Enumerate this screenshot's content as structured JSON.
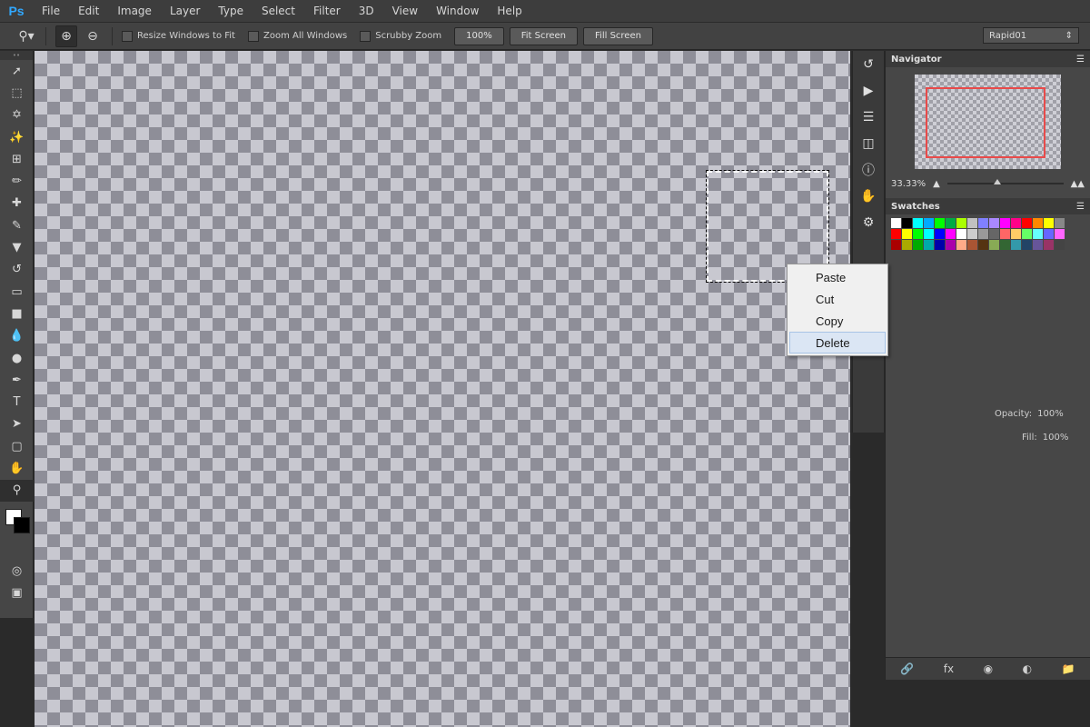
{
  "menubar": {
    "logo": "Ps",
    "items": [
      "File",
      "Edit",
      "Image",
      "Layer",
      "Type",
      "Select",
      "Filter",
      "3D",
      "View",
      "Window",
      "Help"
    ]
  },
  "options": {
    "zoom_in_icon": "zoom-in",
    "zoom_out_icon": "zoom-out",
    "resize_windows": "Resize Windows to Fit",
    "zoom_all_windows": "Zoom All Windows",
    "scrubby_zoom": "Scrubby Zoom",
    "zoom_100": "100%",
    "fit_screen": "Fit Screen",
    "fill_screen": "Fill Screen",
    "workspace": "Rapid01"
  },
  "navigator": {
    "tab": "Navigator",
    "zoom": "33.33%"
  },
  "swatches": {
    "tab": "Swatches",
    "colors": [
      "#ffffff",
      "#000000",
      "#00ffff",
      "#00aaff",
      "#00ff00",
      "#00aa44",
      "#aaff00",
      "#c0c0c0",
      "#8080ff",
      "#aa88ff",
      "#ff00ff",
      "#ff0088",
      "#ff0000",
      "#ff8800",
      "#ffff00",
      "#888888",
      "#ff0000",
      "#ffff00",
      "#00ff00",
      "#00ffff",
      "#0000ff",
      "#ff00ff",
      "#ffffff",
      "#cccccc",
      "#999999",
      "#666666",
      "#ff6666",
      "#ffcc66",
      "#66ff66",
      "#66ffff",
      "#6666ff",
      "#ff66ff",
      "#aa0000",
      "#aaaa00",
      "#00aa00",
      "#00aaaa",
      "#0000aa",
      "#aa00aa",
      "#ffaa88",
      "#aa5533",
      "#553311",
      "#88aa55",
      "#336633",
      "#3399aa",
      "#224466",
      "#665599",
      "#993366",
      "#444444"
    ]
  },
  "layers": {
    "opacity_label": "Opacity:",
    "opacity_value": "100%",
    "fill_label": "Fill:",
    "fill_value": "100%"
  },
  "context_menu": {
    "items": [
      "Paste",
      "Cut",
      "Copy",
      "Delete"
    ],
    "highlighted": "Delete"
  }
}
